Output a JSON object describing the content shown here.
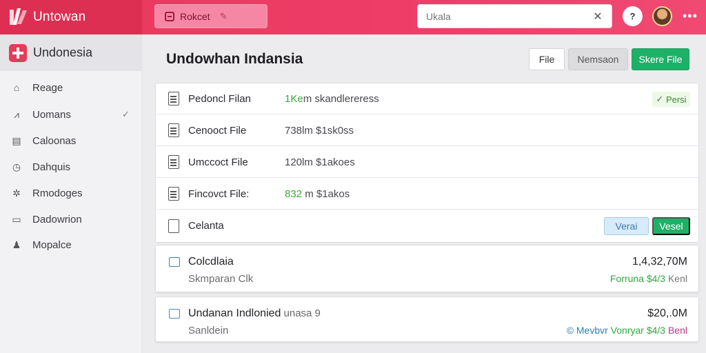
{
  "app": {
    "title": "Untowan"
  },
  "topbar": {
    "action_label": "Rokcet",
    "search_placeholder": "Ukala",
    "clear_glyph": "✕",
    "help_glyph": "?",
    "more_glyph": "•••"
  },
  "sidebar": {
    "header": "Undonesia",
    "items": [
      {
        "label": "Reage",
        "icon": "home-icon"
      },
      {
        "label": "Uomans",
        "icon": "chart-icon"
      },
      {
        "label": "Caloonas",
        "icon": "calendar-icon"
      },
      {
        "label": "Dahquis",
        "icon": "clock-icon"
      },
      {
        "label": "Rmodoges",
        "icon": "gear-icon"
      },
      {
        "label": "Dadowrion",
        "icon": "inbox-icon"
      },
      {
        "label": "Mopalce",
        "icon": "user-icon"
      }
    ]
  },
  "main": {
    "title": "Undowhan Indansia",
    "buttons": {
      "file": "File",
      "rename": "Nemsaon",
      "share": "Skere File"
    },
    "files": [
      {
        "name": "Pedoncl Filan",
        "meta_highlight": "1Ke",
        "meta_rest": "m skandlereress",
        "badge": "Persi"
      },
      {
        "name": "Cenooct File",
        "meta_highlight": "",
        "meta_rest": "738lm $1sk0ss"
      },
      {
        "name": "Umccoct File",
        "meta_highlight": "",
        "meta_rest": "120lm $1akoes"
      },
      {
        "name": "Fincovct File:",
        "meta_highlight": "832",
        "meta_rest": " m $1akos"
      },
      {
        "name": "Celanta",
        "view_label": "Verai",
        "vessel_label": "Vesel"
      }
    ],
    "cards": [
      {
        "title": "Colcdlaia",
        "subtitle": "Skmparan Clk",
        "amount": "1,4,32,70M",
        "foot_green": "Forruna $4/3",
        "foot_rest": " Kenl"
      },
      {
        "title": "Undanan Indlonied",
        "title_muted": " unasa 9",
        "subtitle": "Sanldein",
        "amount": "$20,.0M",
        "foot_blue": "© Mevbvr ",
        "foot_green": "Vonryar $4/3",
        "foot_pink": " Benl"
      }
    ]
  },
  "colors": {
    "accent": "#ee3e69",
    "success": "#1fb068"
  }
}
